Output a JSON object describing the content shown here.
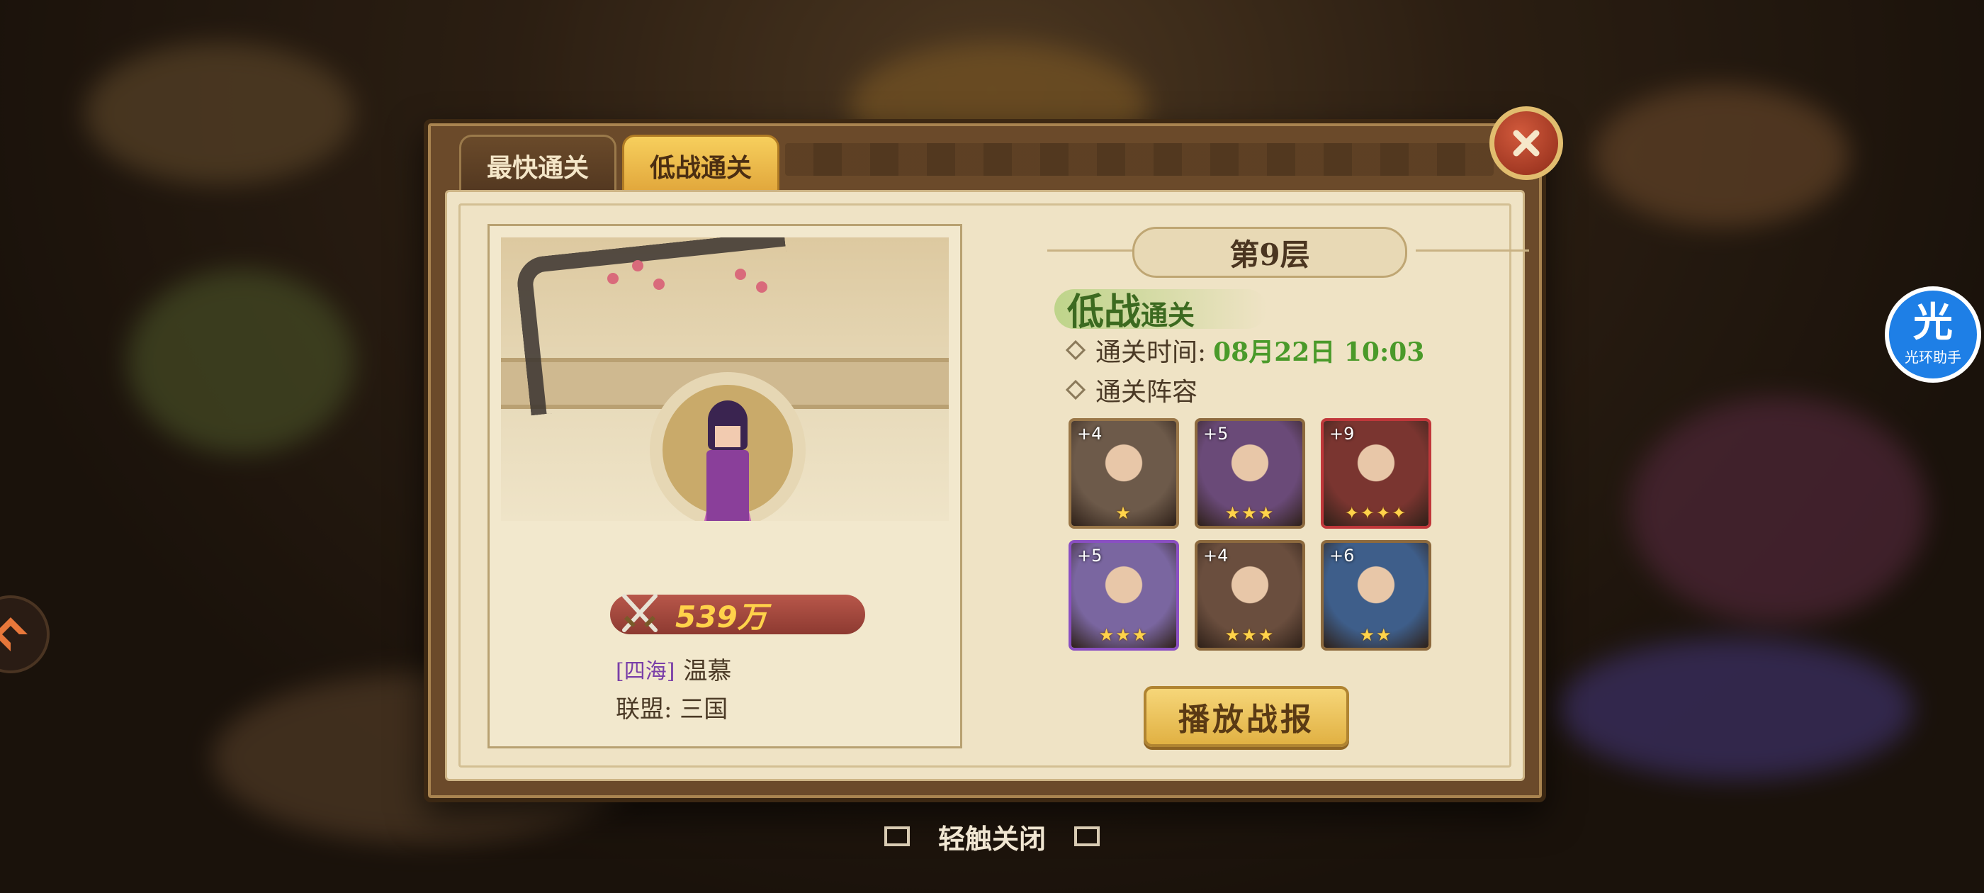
{
  "tabs": [
    {
      "label": "最快通关",
      "active": false
    },
    {
      "label": "低战通关",
      "active": true
    }
  ],
  "floor": "第9层",
  "mode_title_main": "低战",
  "mode_title_sub": "通关",
  "clear_time_label": "通关时间:",
  "clear_time_value": "08月22日 10:03",
  "lineup_label": "通关阵容",
  "player": {
    "power": "539万",
    "server_tag": "[四海]",
    "name": "温慕",
    "alliance": "联盟: 三国"
  },
  "heroes": [
    {
      "plus": "+4",
      "stars": "★",
      "frame": "#9a7748",
      "color": "#6d5a4a"
    },
    {
      "plus": "+5",
      "stars": "★★★",
      "frame": "#8d6a3e",
      "color": "#6a4a78"
    },
    {
      "plus": "+9",
      "stars": "✦✦✦✦",
      "frame": "#c0373a",
      "color": "#7a3530"
    },
    {
      "plus": "+5",
      "stars": "★★★",
      "frame": "#8a4fc2",
      "color": "#7a66a0"
    },
    {
      "plus": "+4",
      "stars": "★★★",
      "frame": "#8d6a3e",
      "color": "#6a4e3e"
    },
    {
      "plus": "+6",
      "stars": "★★",
      "frame": "#8d6a3e",
      "color": "#3e5e8a"
    }
  ],
  "replay_button": "播放战报",
  "tap_to_close": "轻触关闭",
  "assistant": {
    "glyph": "光",
    "label": "光环助手"
  },
  "colors": {
    "accent_gold": "#e1b143",
    "time_green": "#4a9a2a",
    "close_red": "#8e2b19"
  }
}
